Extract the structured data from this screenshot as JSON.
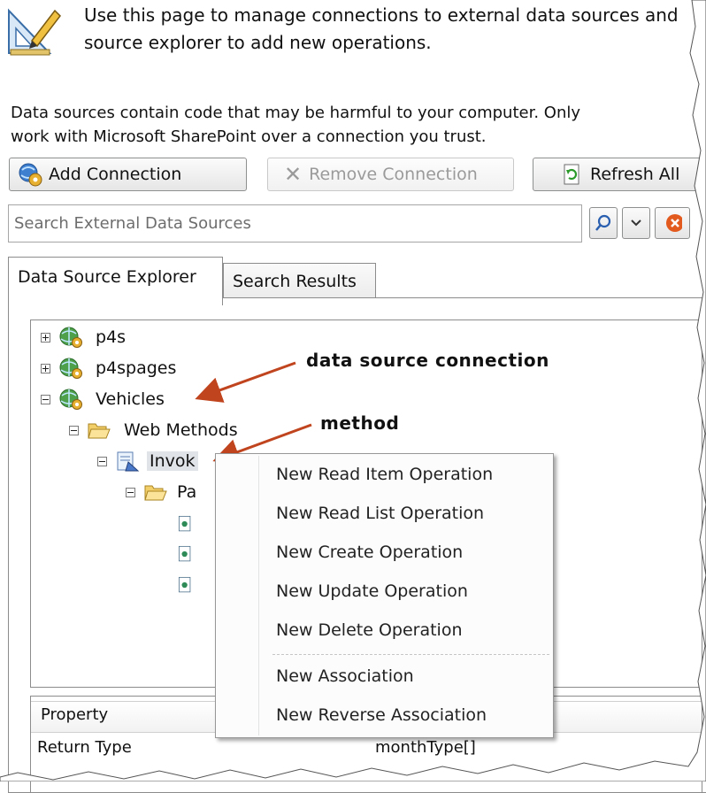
{
  "intro": {
    "icon": "ruler-pencil-icon",
    "text": "Use this page to manage connections to external data sources and\nsource explorer to add new operations."
  },
  "warning": {
    "text": "Data sources contain code that may be harmful to your computer. Only\nwork with Microsoft SharePoint over a connection you trust."
  },
  "toolbar": {
    "add_connection": "Add Connection",
    "remove_connection": "Remove Connection",
    "refresh_all": "Refresh All"
  },
  "search": {
    "placeholder": "Search External Data Sources"
  },
  "tabs": {
    "explorer": "Data Source Explorer",
    "results": "Search Results"
  },
  "tree": {
    "nodes": [
      {
        "label": "p4s",
        "expander": "plus",
        "icon": "globe-gear-icon"
      },
      {
        "label": "p4spages",
        "expander": "plus",
        "icon": "globe-gear-icon"
      },
      {
        "label": "Vehicles",
        "expander": "minus",
        "icon": "globe-gear-icon"
      },
      {
        "label": "Web Methods",
        "expander": "minus",
        "icon": "folder-open-icon"
      },
      {
        "label": "Invok",
        "expander": "minus",
        "icon": "method-icon",
        "selected": true
      },
      {
        "label": "Pa",
        "expander": "minus",
        "icon": "folder-open-icon"
      },
      {
        "label": "",
        "icon": "document-icon"
      },
      {
        "label": "",
        "icon": "document-icon"
      },
      {
        "label": "",
        "icon": "document-icon"
      }
    ]
  },
  "annotations": {
    "connection": "data source connection",
    "method": "method",
    "arrow_color": "#c0441e"
  },
  "properties": {
    "header_property": "Property",
    "rows": [
      {
        "name": "Return Type",
        "value": "monthType[]"
      }
    ]
  },
  "context_menu": {
    "items": [
      "New Read Item Operation",
      "New Read List Operation",
      "New Create Operation",
      "New Update Operation",
      "New Delete Operation",
      "New Association",
      "New Reverse Association"
    ]
  },
  "close_glyph": "×"
}
